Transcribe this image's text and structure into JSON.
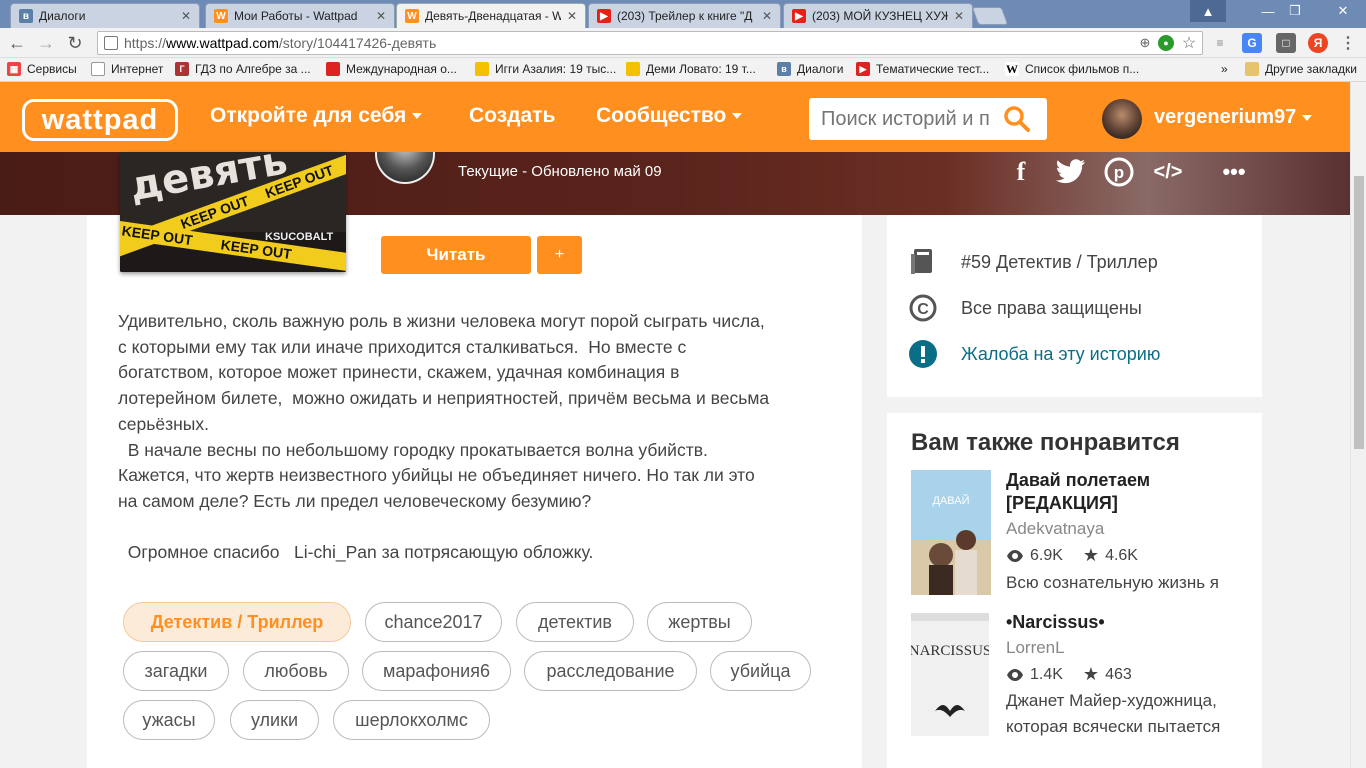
{
  "browser": {
    "tabs": [
      {
        "title": "Диалоги",
        "icon": "vk-icon",
        "active": false
      },
      {
        "title": "Мои Работы - Wattpad",
        "icon": "wattpad-icon",
        "active": false
      },
      {
        "title": "Девять-Двенадцатая - W",
        "icon": "wattpad-icon",
        "active": true
      },
      {
        "title": "(203) Трейлер к книге \"Д",
        "icon": "youtube-icon",
        "active": false
      },
      {
        "title": "(203) МОЙ КУЗНЕЦ ХУЖ",
        "icon": "youtube-icon",
        "active": false
      }
    ],
    "url": {
      "scheme": "https://",
      "host": "www.wattpad.com",
      "path": "/story/104417426-девять"
    },
    "bookmarks": [
      {
        "label": "Сервисы",
        "icon": "apps-icon"
      },
      {
        "label": "Интернет",
        "icon": "page-icon"
      },
      {
        "label": "ГДЗ по Алгебре за ...",
        "icon": "gdz-icon"
      },
      {
        "label": "Международная о...",
        "icon": "red-icon"
      },
      {
        "label": "Игги Азалия: 19 тыс...",
        "icon": "yellow-icon"
      },
      {
        "label": "Деми Ловато: 19 т...",
        "icon": "yellow-icon"
      },
      {
        "label": "Диалоги",
        "icon": "vk-icon"
      },
      {
        "label": "Тематические тест...",
        "icon": "play-icon"
      },
      {
        "label": "Список фильмов п...",
        "icon": "wiki-icon"
      }
    ],
    "bookmarks_more": "»",
    "other_bookmarks": "Другие закладки"
  },
  "header": {
    "logo": "wattpad",
    "nav": [
      "Откройте для себя",
      "Создать",
      "Сообщество"
    ],
    "search_placeholder": "Поиск историй и п",
    "username": "vergenerium97"
  },
  "story": {
    "status_line": "Текущие - Обновлено май 09",
    "cover_title": "девять",
    "cover_tape": [
      "KEEP OUT",
      "KEEP OUT",
      "KEEP OUT",
      "KEEP OUT"
    ],
    "cover_author": "KSUCOBALT",
    "read_label": "Читать",
    "add_label": "+",
    "description": "Удивительно, сколь важную роль в жизни человека могут порой сыграть числа,\nс которыми ему так или иначе приходится сталкиваться.  Но вместе с\nбогатством, которое может принести, скажем, удачная комбинация в\nлотерейном билете,  можно ожидать и неприятностей, причём весьма и весьма\nсерьёзных.\n  В начале весны по небольшому городку прокатывается волна убийств.\nКажется, что жертв неизвестного убийцы не объединяет ничего. Но так ли это\nна самом деле? Есть ли предел человеческому безумию?\n\n  Огромное спасибо   Li-chi_Pan за потрясающую обложку.",
    "tags": [
      "Детектив / Триллер",
      "chance2017",
      "детектив",
      "жертвы",
      "загадки",
      "любовь",
      "марафония6",
      "расследование",
      "убийца",
      "ужасы",
      "улики",
      "шерлокхолмс"
    ]
  },
  "sidebar": {
    "rank": "#59 Детектив / Триллер",
    "copyright": "Все права защищены",
    "report": "Жалоба на эту историю",
    "rec_heading": "Вам также понравится",
    "recs": [
      {
        "title": "Давай полетаем [РЕДАКЦИЯ]",
        "cover_text": "ДАВАЙ",
        "author": "Adekvatnaya",
        "reads": "6.9K",
        "votes": "4.6K",
        "desc": "Всю сознательную жизнь я"
      },
      {
        "title": "•Narcissus•",
        "cover_text": "NARCISSUS",
        "author": "LorrenL",
        "reads": "1.4K",
        "votes": "463",
        "desc": "Джанет Майер-художница, которая всячески пытается"
      }
    ]
  },
  "colors": {
    "brand": "#ff8f1f",
    "report": "#0a6e86"
  }
}
